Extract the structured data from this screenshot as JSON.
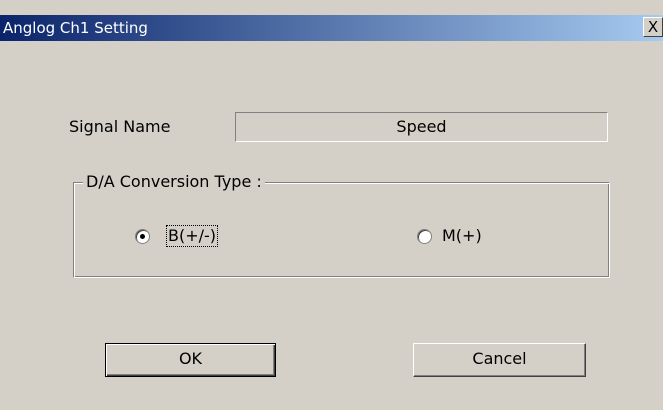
{
  "window": {
    "title": "Anglog Ch1 Setting",
    "close_glyph": "X",
    "colors": {
      "face": "#d4d0c8",
      "titlebar_start": "#0a246a",
      "titlebar_end": "#a6caf0"
    }
  },
  "signal": {
    "label": "Signal Name",
    "value": "Speed"
  },
  "conversion": {
    "group_label": "D/A Conversion Type :",
    "options": [
      {
        "label": "B(+/-)",
        "selected": true
      },
      {
        "label": "M(+)",
        "selected": false
      }
    ]
  },
  "buttons": {
    "ok": "OK",
    "cancel": "Cancel"
  },
  "icons": {
    "close": "close-icon"
  }
}
